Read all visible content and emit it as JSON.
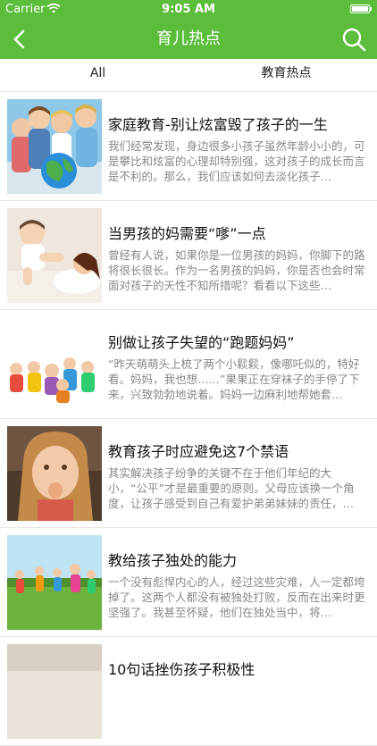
{
  "status": {
    "carrier": "Carrier",
    "time": "9:05 AM"
  },
  "nav": {
    "title": "育儿热点",
    "back_icon": "chevron-left-icon",
    "search_icon": "search-icon"
  },
  "tabs": [
    {
      "label": "All"
    },
    {
      "label": "教育热点"
    }
  ],
  "articles": [
    {
      "title": "家庭教育-别让炫富毁了孩子的一生",
      "summary": "我们经常发现，身边很多小孩子虽然年龄小小的，可是攀比和炫富的心理却特别强，这对孩子的成长而言是不利的。那么，我们应该如何去淡化孩子…"
    },
    {
      "title": "当男孩的妈需要“嗲”一点",
      "summary": "曾经有人说，如果你是一位男孩的妈妈，你脚下的路将很长很长。作为一名男孩的妈妈，你是否也会时常面对孩子的天性不知所措呢？看看以下这些…"
    },
    {
      "title": "别做让孩子失望的“跑题妈妈”",
      "summary": "“昨天萌萌头上梳了两个小鬏鬏，像哪吒似的，特好看。妈妈，我也想……”果果正在穿袜子的手停了下来，兴致勃勃地说着。妈妈一边麻利地帮她套…"
    },
    {
      "title": "教育孩子时应避免这7个禁语",
      "summary": "其实解决孩子纷争的关键不在于他们年纪的大小，“公平”才是最重要的原则。父母应该换一个角度，让孩子感受到自己有爱护弟弟妹妹的责任，…"
    },
    {
      "title": "教给孩子独处的能力",
      "summary": "一个没有彪悍内心的人，经过这些灾难，人一定都垮掉了。这两个人都没有被独处打败，反而在出来时更坚强了。我甚至怀疑，他们在独处当中，将…"
    },
    {
      "title": "10句话挫伤孩子积极性",
      "summary": ""
    }
  ],
  "colors": {
    "brand_green": "#5bbd3b"
  }
}
